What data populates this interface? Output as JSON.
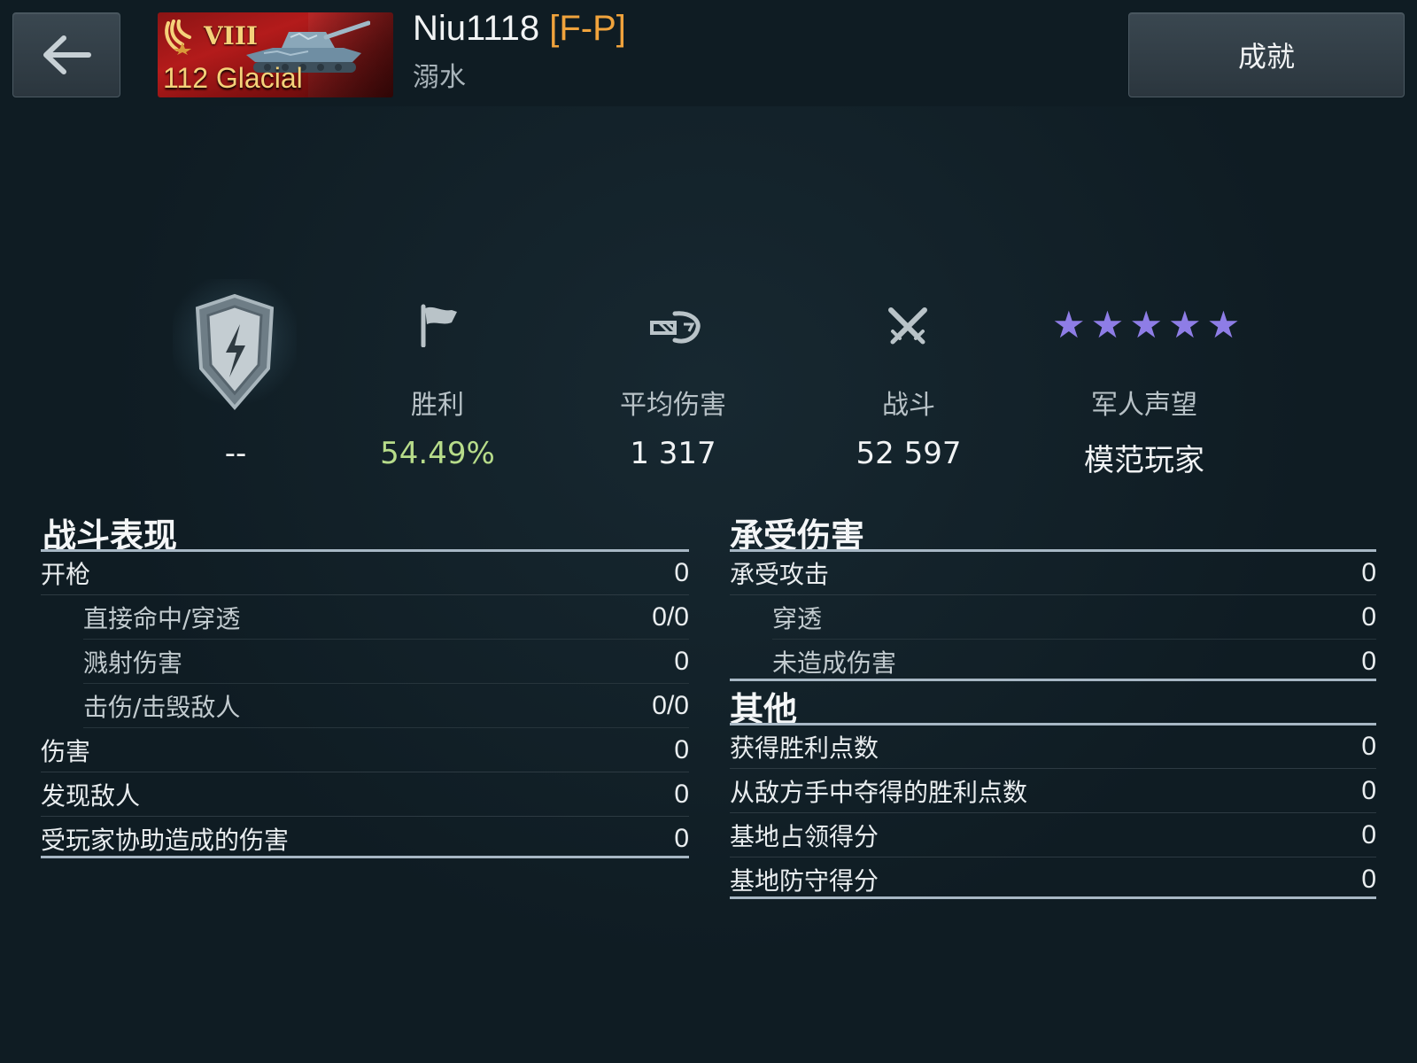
{
  "header": {
    "tank_tier": "VIII",
    "tank_name": "112 Glacial",
    "player_name": "Niu1118",
    "clan_tag": "[F-P]",
    "status": "溺水",
    "achievements_label": "成就"
  },
  "stats": {
    "rank_value": "--",
    "victories_label": "胜利",
    "victories_value": "54.49%",
    "avg_damage_label": "平均伤害",
    "avg_damage_value": "1 317",
    "battles_label": "战斗",
    "battles_value": "52 597",
    "reputation_label": "军人声望",
    "reputation_value": "模范玩家",
    "reputation_stars": 5,
    "star_color": "#8e7de6"
  },
  "combat": {
    "title": "战斗表现",
    "rows": [
      {
        "label": "开枪",
        "value": "0"
      },
      {
        "label": "直接命中/穿透",
        "value": "0/0"
      },
      {
        "label": "溅射伤害",
        "value": "0"
      },
      {
        "label": "击伤/击毁敌人",
        "value": "0/0"
      },
      {
        "label": "伤害",
        "value": "0"
      },
      {
        "label": "发现敌人",
        "value": "0"
      },
      {
        "label": "受玩家协助造成的伤害",
        "value": "0"
      }
    ]
  },
  "received": {
    "title": "承受伤害",
    "rows": [
      {
        "label": "承受攻击",
        "value": "0"
      },
      {
        "label": "穿透",
        "value": "0"
      },
      {
        "label": "未造成伤害",
        "value": "0"
      }
    ]
  },
  "other": {
    "title": "其他",
    "rows": [
      {
        "label": "获得胜利点数",
        "value": "0"
      },
      {
        "label": "从敌方手中夺得的胜利点数",
        "value": "0"
      },
      {
        "label": "基地占领得分",
        "value": "0"
      },
      {
        "label": "基地防守得分",
        "value": "0"
      }
    ]
  }
}
